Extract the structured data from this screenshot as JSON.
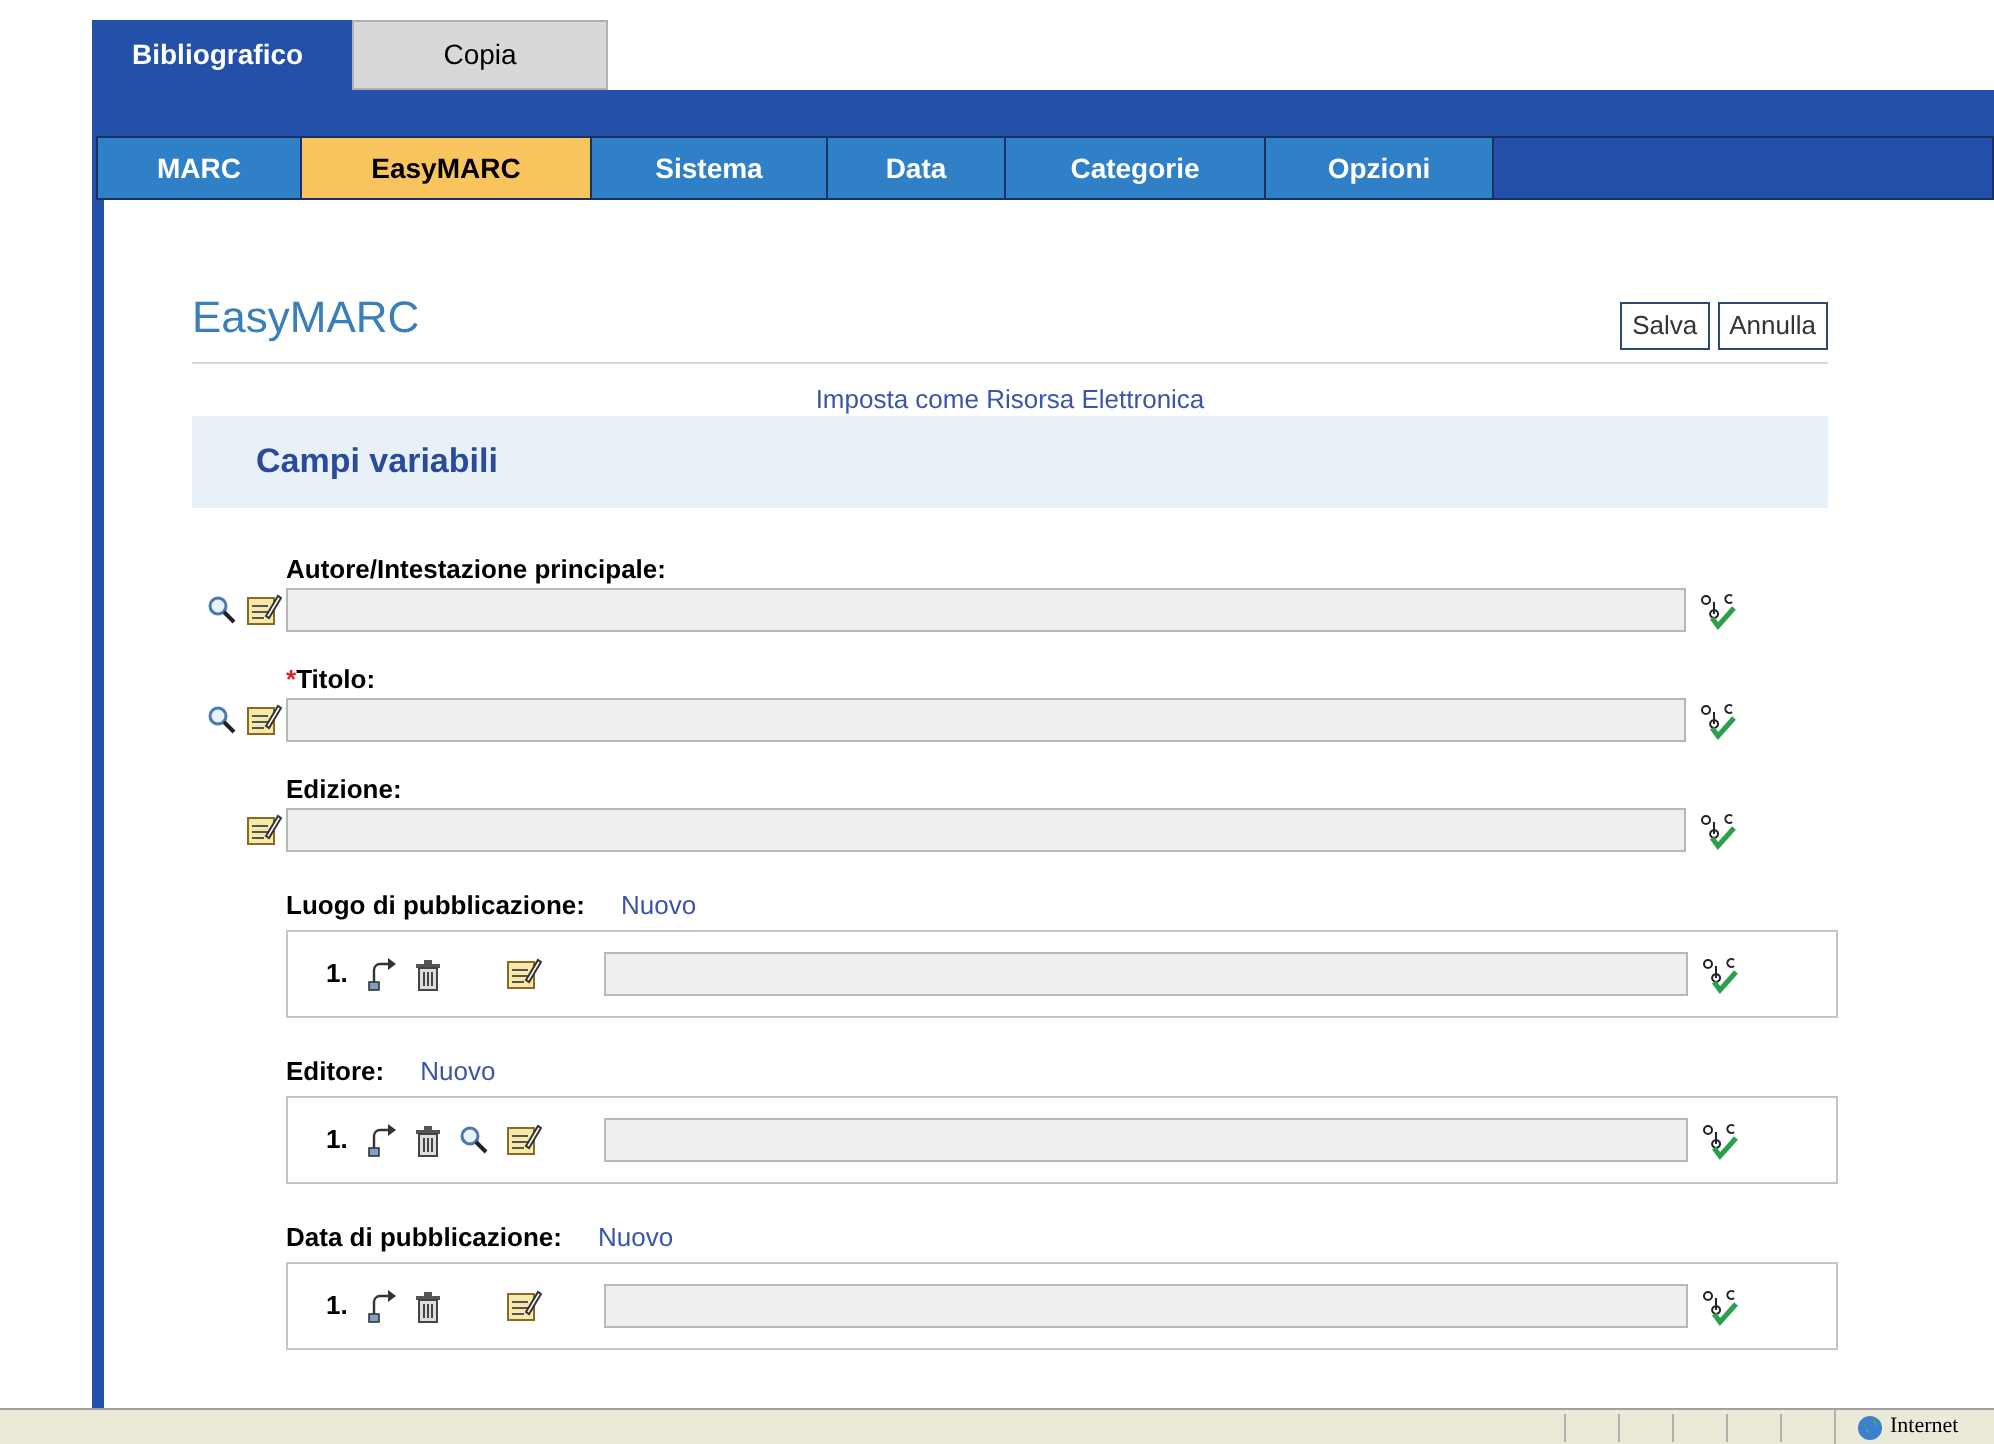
{
  "top_tabs": [
    {
      "label": "Bibliografico",
      "selected": true
    },
    {
      "label": "Copia",
      "selected": false
    }
  ],
  "sub_tabs": [
    {
      "label": "MARC",
      "selected": false
    },
    {
      "label": "EasyMARC",
      "selected": true
    },
    {
      "label": "Sistema",
      "selected": false
    },
    {
      "label": "Data",
      "selected": false
    },
    {
      "label": "Categorie",
      "selected": false
    },
    {
      "label": "Opzioni",
      "selected": false
    }
  ],
  "page_title": "EasyMARC",
  "buttons": [
    "Salva",
    "Annulla"
  ],
  "electronic_link": "Imposta come Risorsa Elettronica",
  "section_title": "Campi variabili",
  "fields": [
    {
      "kind": "single",
      "label": "Autore/Intestazione principale:",
      "search": true
    },
    {
      "kind": "single",
      "label": "Titolo:",
      "required_mark": "*",
      "search": true
    },
    {
      "kind": "single",
      "label": "Edizione:",
      "search": false
    },
    {
      "kind": "repeat",
      "label": "Luogo di pubblicazione:",
      "new_link": "Nuovo",
      "entries": [
        {
          "number": "1.",
          "search": false
        }
      ]
    },
    {
      "kind": "repeat",
      "label": "Editore:",
      "new_link": "Nuovo",
      "entries": [
        {
          "number": "1.",
          "search": true
        }
      ]
    },
    {
      "kind": "repeat",
      "label": "Data di pubblicazione:",
      "new_link": "Nuovo",
      "entries": [
        {
          "number": "1.",
          "search": false
        }
      ]
    }
  ],
  "status_bar": {
    "zone": "Internet"
  }
}
